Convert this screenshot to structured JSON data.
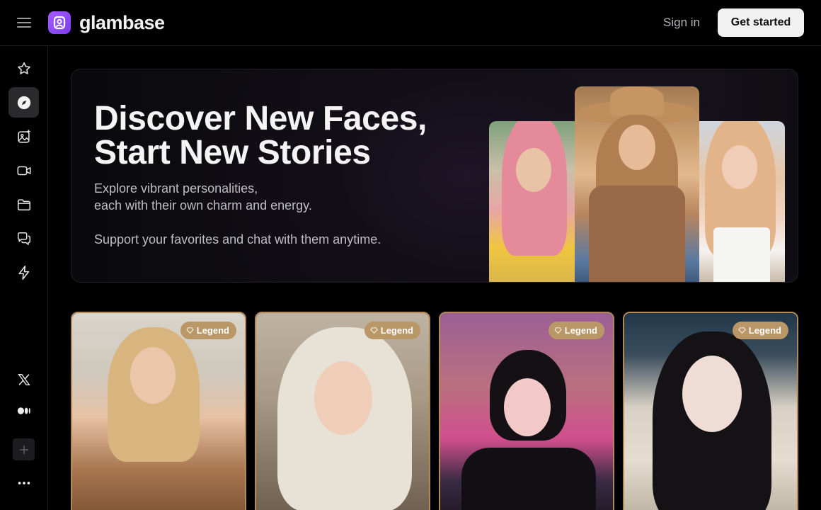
{
  "header": {
    "brand": "glambase",
    "sign_in": "Sign in",
    "get_started": "Get started"
  },
  "sidebar": {
    "items": [
      {
        "name": "favorites",
        "icon": "star-icon"
      },
      {
        "name": "explore",
        "icon": "compass-icon",
        "active": true
      },
      {
        "name": "images",
        "icon": "image-plus-icon"
      },
      {
        "name": "videos",
        "icon": "video-icon"
      },
      {
        "name": "collections",
        "icon": "folder-icon"
      },
      {
        "name": "chats",
        "icon": "chat-icon"
      },
      {
        "name": "boost",
        "icon": "bolt-icon"
      }
    ],
    "footer": [
      {
        "name": "x",
        "icon": "x-logo-icon"
      },
      {
        "name": "medium",
        "icon": "medium-logo-icon"
      },
      {
        "name": "add",
        "icon": "plus-icon"
      },
      {
        "name": "more",
        "icon": "more-icon"
      }
    ]
  },
  "hero": {
    "title_line1": "Discover New Faces,",
    "title_line2": "Start New Stories",
    "subtitle_line1": "Explore vibrant personalities,",
    "subtitle_line2": "each with their own charm and energy.",
    "support": "Support your favorites and chat with them anytime."
  },
  "cards": [
    {
      "badge": "Legend"
    },
    {
      "badge": "Legend"
    },
    {
      "badge": "Legend"
    },
    {
      "badge": "Legend"
    }
  ],
  "colors": {
    "brand": "#8a4af3",
    "badge": "#b99766",
    "card_border": "#b08a5a"
  }
}
